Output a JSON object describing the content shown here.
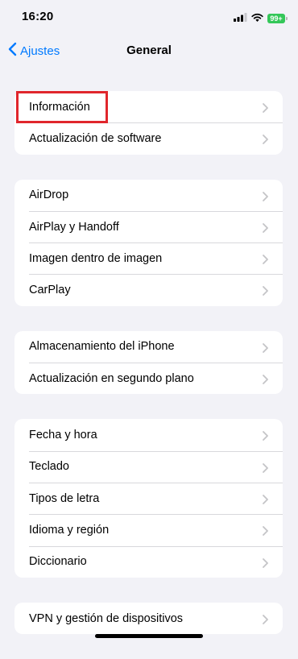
{
  "status": {
    "time": "16:20",
    "battery": "99+"
  },
  "nav": {
    "back_label": "Ajustes",
    "title": "General"
  },
  "groups": [
    {
      "items": [
        {
          "label": "Información"
        },
        {
          "label": "Actualización de software"
        }
      ]
    },
    {
      "items": [
        {
          "label": "AirDrop"
        },
        {
          "label": "AirPlay y Handoff"
        },
        {
          "label": "Imagen dentro de imagen"
        },
        {
          "label": "CarPlay"
        }
      ]
    },
    {
      "items": [
        {
          "label": "Almacenamiento del iPhone"
        },
        {
          "label": "Actualización en segundo plano"
        }
      ]
    },
    {
      "items": [
        {
          "label": "Fecha y hora"
        },
        {
          "label": "Teclado"
        },
        {
          "label": "Tipos de letra"
        },
        {
          "label": "Idioma y región"
        },
        {
          "label": "Diccionario"
        }
      ]
    },
    {
      "items": [
        {
          "label": "VPN y gestión de dispositivos"
        }
      ]
    }
  ],
  "colors": {
    "accent": "#007aff",
    "highlight": "#e0262c",
    "battery": "#34c759",
    "background": "#f2f2f7"
  }
}
